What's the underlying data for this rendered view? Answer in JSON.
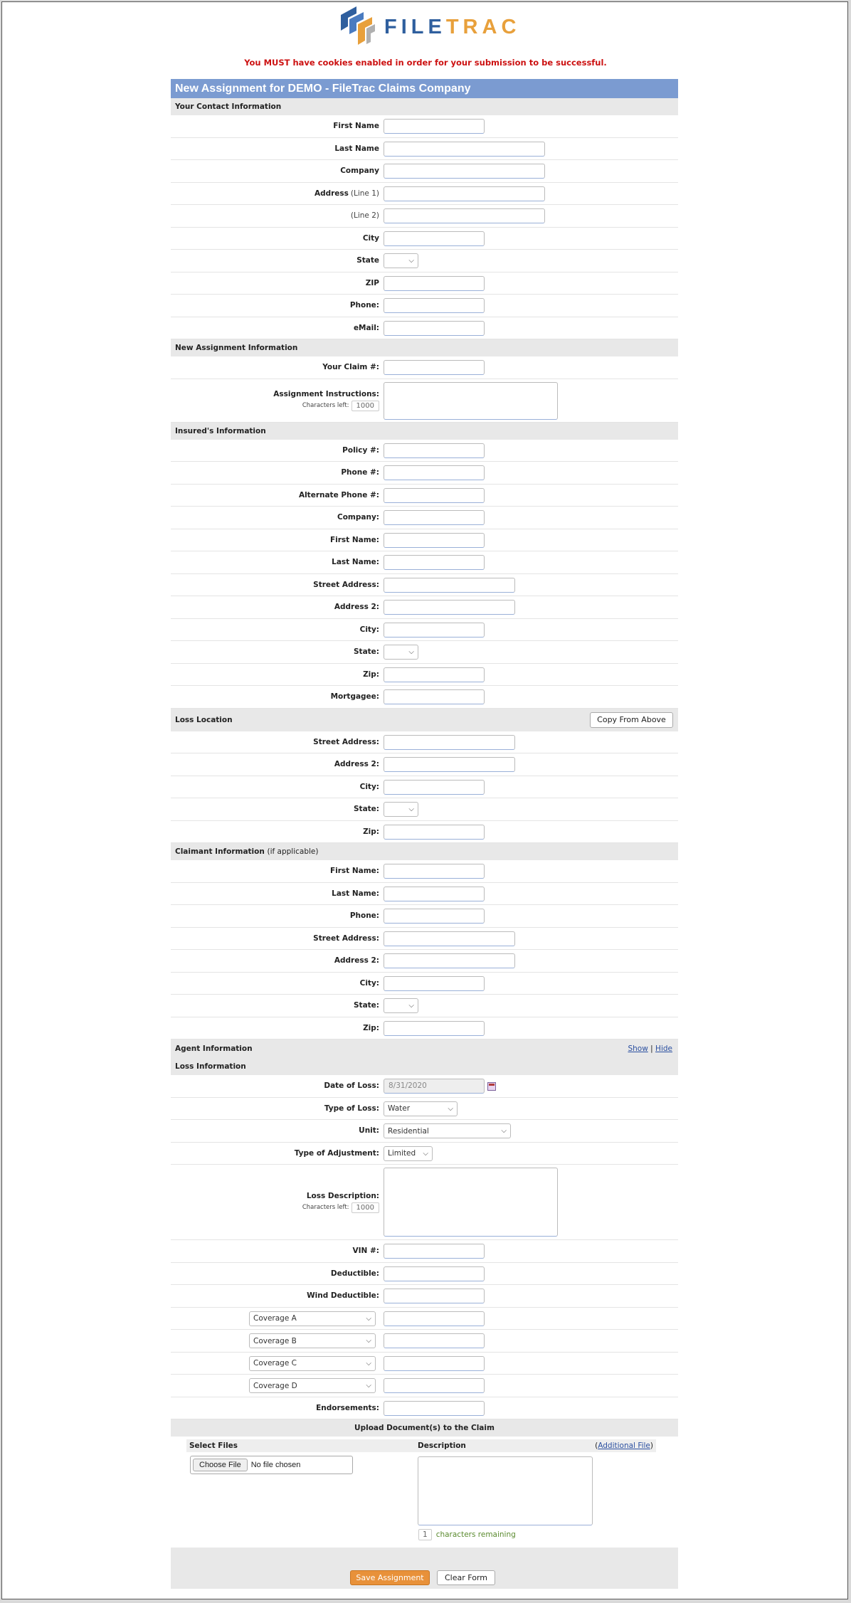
{
  "brand": {
    "logo_part1": "FILE",
    "logo_part2": "TRAC"
  },
  "warning": "You MUST have cookies enabled in order for your submission to be successful.",
  "form_title": "New Assignment for DEMO - FileTrac Claims Company",
  "contact": {
    "heading": "Your Contact Information",
    "first_name": "First Name",
    "last_name": "Last Name",
    "company": "Company",
    "address": "Address",
    "line1": "(Line 1)",
    "line2": "(Line 2)",
    "city": "City",
    "state": "State",
    "zip": "ZIP",
    "phone": "Phone:",
    "email": "eMail:"
  },
  "assignment": {
    "heading": "New Assignment Information",
    "claim_no": "Your Claim #:",
    "instructions": "Assignment Instructions:",
    "chars_left_label": "Characters left:",
    "chars_left_value": "1000"
  },
  "insured": {
    "heading": "Insured's Information",
    "policy": "Policy #:",
    "phone": "Phone #:",
    "alt_phone": "Alternate Phone #:",
    "company": "Company:",
    "first_name": "First Name:",
    "last_name": "Last Name:",
    "street": "Street Address:",
    "address2": "Address 2:",
    "city": "City:",
    "state": "State:",
    "zip": "Zip:",
    "mortgagee": "Mortgagee:"
  },
  "loss_location": {
    "heading": "Loss Location",
    "copy_button": "Copy From Above",
    "street": "Street Address:",
    "address2": "Address 2:",
    "city": "City:",
    "state": "State:",
    "zip": "Zip:"
  },
  "claimant": {
    "heading": "Claimant Information",
    "heading_note": "(if applicable)",
    "first_name": "First Name:",
    "last_name": "Last Name:",
    "phone": "Phone:",
    "street": "Street Address:",
    "address2": "Address 2:",
    "city": "City:",
    "state": "State:",
    "zip": "Zip:"
  },
  "agent": {
    "heading": "Agent Information",
    "show": "Show",
    "separator": "|",
    "hide": "Hide"
  },
  "loss": {
    "heading": "Loss Information",
    "date_label": "Date of Loss:",
    "date_value": "8/31/2020",
    "type_label": "Type of Loss:",
    "type_value": "Water",
    "unit_label": "Unit:",
    "unit_value": "Residential",
    "adjust_label": "Type of Adjustment:",
    "adjust_value": "Limited",
    "desc_label": "Loss Description:",
    "chars_left_label": "Characters left:",
    "chars_left_value": "1000",
    "vin": "VIN #:",
    "deductible": "Deductible:",
    "wind_deductible": "Wind Deductible:",
    "coverage_a": "Coverage A",
    "coverage_b": "Coverage B",
    "coverage_c": "Coverage C",
    "coverage_d": "Coverage D",
    "endorsements": "Endorsements:"
  },
  "upload": {
    "heading": "Upload Document(s) to the Claim",
    "select_files": "Select Files",
    "description": "Description",
    "additional_file_open": "(",
    "additional_file": "Additional File",
    "additional_file_close": ")",
    "choose_file": "Choose File",
    "no_file": "No file chosen",
    "remaining_count": "1",
    "remaining_text": "characters remaining"
  },
  "actions": {
    "save": "Save Assignment",
    "clear": "Clear Form"
  },
  "colors": {
    "title_bar": "#7b9bd1",
    "save_button": "#e8913a",
    "warning": "#cc1111"
  }
}
